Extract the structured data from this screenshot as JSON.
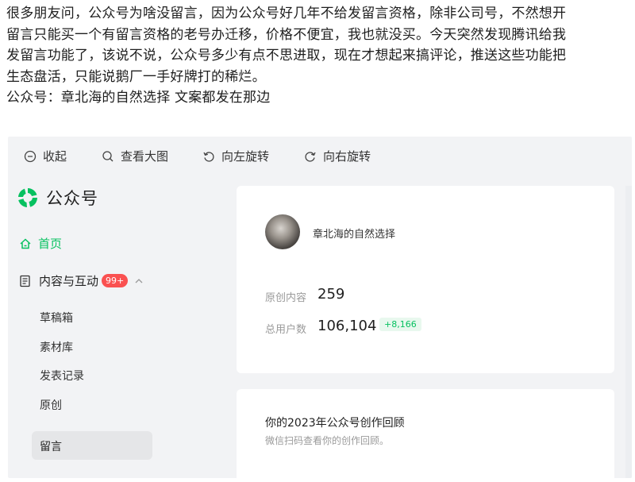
{
  "post": {
    "lines": [
      "很多朋友问，公众号为啥没留言，因为公众号好几年不给发留言资格，除非公司号，不然想开",
      "留言只能买一个有留言资格的老号办迁移，价格不便宜，我也就没买。今天突然发现腾讯给我",
      "发留言功能了，该说不说，公众号多少有点不思进取，现在才想起来搞评论，推送这些功能把",
      "生态盘活，只能说鹅厂一手好牌打的稀烂。",
      "公众号：章北海的自然选择 文案都发在那边"
    ]
  },
  "toolbar": {
    "collapse": "收起",
    "view_large": "查看大图",
    "rotate_left": "向左旋转",
    "rotate_right": "向右旋转"
  },
  "sidebar": {
    "logo_text": "公众号",
    "home": "首页",
    "content_interaction": "内容与互动",
    "badge": "99+",
    "sub_items": [
      "草稿箱",
      "素材库",
      "发表记录",
      "原创",
      "留言"
    ]
  },
  "account": {
    "name": "章北海的自然选择",
    "original_label": "原创内容",
    "original_value": "259",
    "users_label": "总用户数",
    "users_value": "106,104",
    "users_delta": "+8,166"
  },
  "review": {
    "title": "你的2023年公众号创作回顾",
    "subtitle": "微信扫码查看你的创作回顾。"
  },
  "colors": {
    "accent": "#07c160",
    "badge": "#fa5151"
  }
}
